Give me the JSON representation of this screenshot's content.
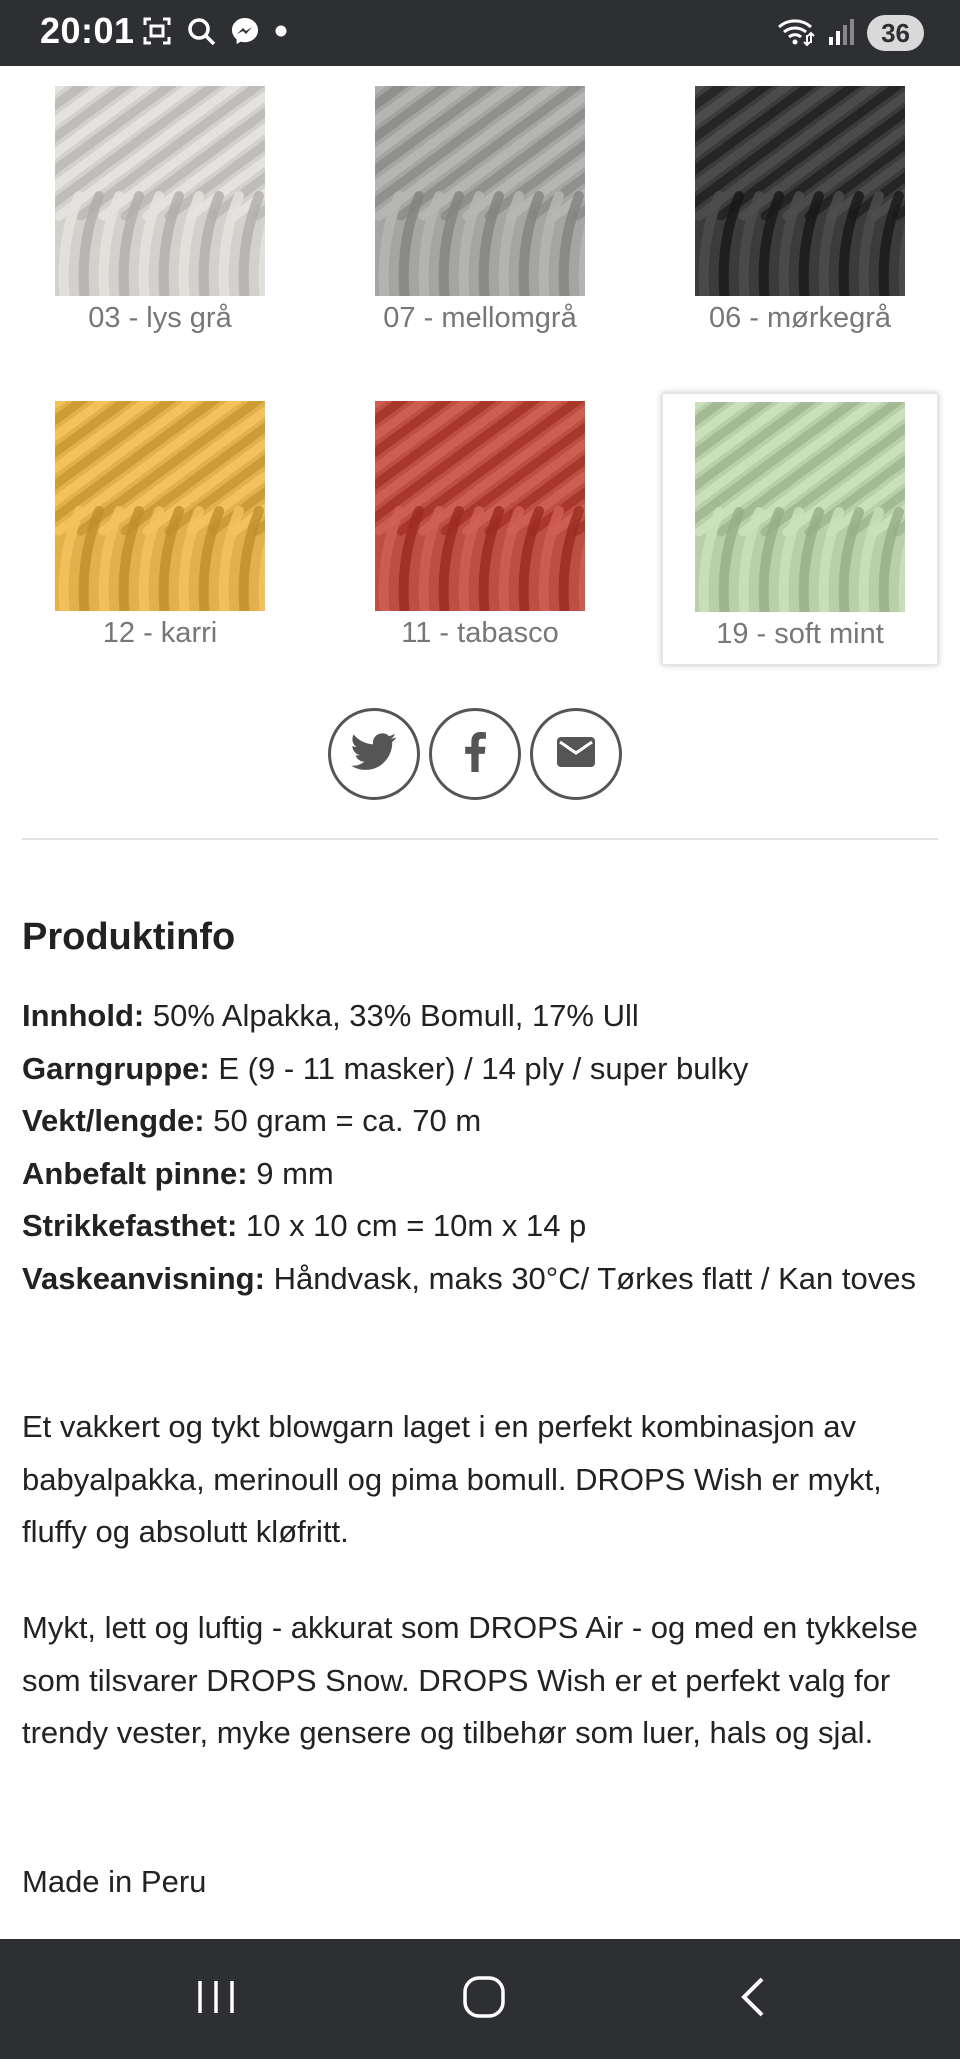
{
  "status_bar": {
    "time": "20:01",
    "left_icons": [
      "screenshot-icon",
      "search-icon",
      "messenger-icon",
      "dot-icon"
    ],
    "right_icons": [
      "wifi-icon",
      "signal-icon"
    ],
    "battery": "36"
  },
  "swatches": [
    {
      "label": "03 - lys grå",
      "color": "#d3d1cd",
      "selected": false
    },
    {
      "label": "07 - mellomgrå",
      "color": "#a5a5a3",
      "selected": false
    },
    {
      "label": "06 - mørkegrå",
      "color": "#3b3b3b",
      "selected": false
    },
    {
      "label": "12 - karri",
      "color": "#e3b14a",
      "selected": false
    },
    {
      "label": "11 - tabasco",
      "color": "#bd4e42",
      "selected": false
    },
    {
      "label": "19 - soft mint",
      "color": "#b9cfaa",
      "selected": true
    }
  ],
  "share": {
    "icons": [
      "twitter-icon",
      "facebook-icon",
      "email-icon"
    ]
  },
  "product_info": {
    "title": "Produktinfo",
    "specs": [
      {
        "label": "Innhold:",
        "value": " 50% Alpakka, 33% Bomull, 17% Ull"
      },
      {
        "label": "Garngruppe:",
        "value": " E (9 - 11 masker) / 14 ply / super bulky"
      },
      {
        "label": "Vekt/lengde:",
        "value": " 50 gram = ca. 70 m"
      },
      {
        "label": "Anbefalt pinne:",
        "value": " 9 mm"
      },
      {
        "label": "Strikkefasthet:",
        "value": " 10 x 10 cm = 10m x 14 p"
      },
      {
        "label": "Vaskeanvisning:",
        "value": " Håndvask, maks 30°C/ Tørkes flatt / Kan toves"
      }
    ],
    "paragraphs": [
      "Et vakkert og tykt blowgarn laget i en perfekt kombinasjon av babyalpakka, merinoull og pima bomull. DROPS Wish er mykt, fluffy og absolutt kløfritt.",
      "Mykt, lett og luftig - akkurat som DROPS Air - og med en tykkelse som tilsvarer DROPS Snow. DROPS Wish er et perfekt valg for trendy vester, myke gensere og tilbehør som luer, hals og sjal.",
      "Made in Peru"
    ]
  },
  "nav_bar": {
    "buttons": [
      "recent-apps-icon",
      "home-icon",
      "back-icon"
    ]
  }
}
